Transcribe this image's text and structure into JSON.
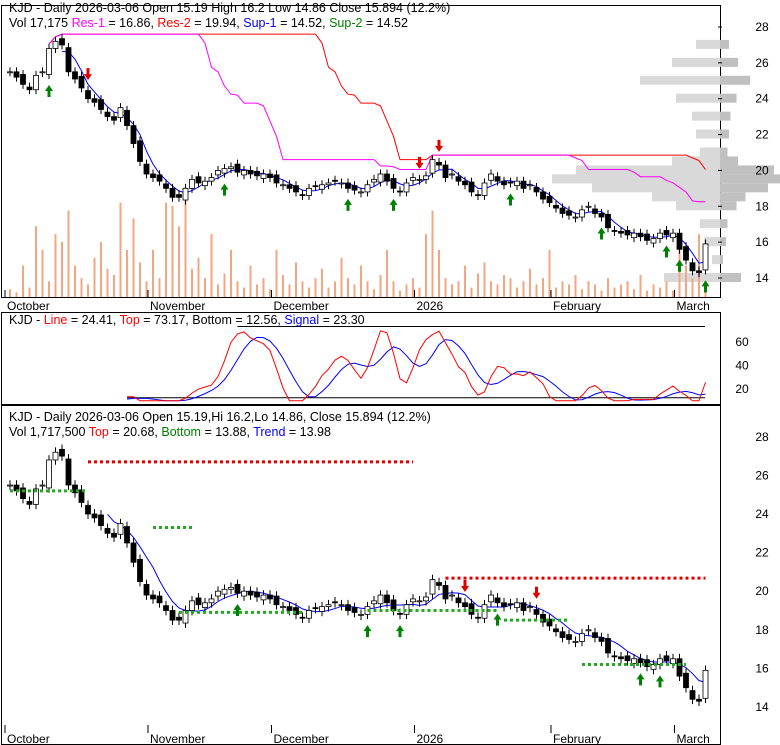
{
  "panel1": {
    "title": "KJD - Daily 2026-03-06 Open 15.19  High 16.2  Low 14.86  Close 15.894 (12.2%)",
    "vol": "Vol 17,175",
    "res1_label": "Res-1",
    "res1_val": " = 16.86, ",
    "res2_label": "Res-2",
    "res2_val": " = 19.94, ",
    "sup1_label": "Sup-1",
    "sup1_val": " = 14.52, ",
    "sup2_label": "Sup-2",
    "sup2_val": " = 14.52"
  },
  "panel2": {
    "ticker": "KJD - ",
    "line_label": "Line",
    "line_val": " = 24.41, ",
    "top_label": "Top",
    "top_val": " = 73.17, ",
    "bottom_label": "Bottom",
    "bottom_val": " = 12.56, ",
    "signal_label": "Signal",
    "signal_val": " = 23.30"
  },
  "panel3": {
    "title": "KJD - Daily 2026-03-06 Open 15.19,Hi 16.2,Lo 14.86, Close 15.894 (12.2%)",
    "vol": "Vol 1,717,500 ",
    "top_label": "Top",
    "top_val": " = 20.68, ",
    "bottom_label": "Bottom",
    "bottom_val": " = 13.88, ",
    "trend_label": "Trend",
    "trend_val": " = 13.98"
  },
  "colors": {
    "res1": "#ff00ff",
    "res2": "#ff0000",
    "sup1": "#0000ff",
    "sup2": "#008000",
    "volume": "#f4a582",
    "profile": "#c0c0c0"
  },
  "chart_data": {
    "type": "candlestick",
    "x_labels": [
      {
        "label": "October",
        "index": 0
      },
      {
        "label": "November",
        "index": 22
      },
      {
        "label": "December",
        "index": 41
      },
      {
        "label": "2026",
        "index": 63
      },
      {
        "label": "February",
        "index": 84
      },
      {
        "label": "March",
        "index": 103
      }
    ],
    "price_ticks": [
      14,
      16,
      18,
      20,
      22,
      24,
      26,
      28
    ],
    "osc_ticks": [
      20,
      40,
      60
    ],
    "ylim": [
      13,
      29
    ],
    "close": [
      25.5,
      25.2,
      24.8,
      24.5,
      25.3,
      25.5,
      26.8,
      27.2,
      27.0,
      25.5,
      25.1,
      24.6,
      24.0,
      23.8,
      23.4,
      23.0,
      22.8,
      23.5,
      22.5,
      21.5,
      20.5,
      19.8,
      19.6,
      19.4,
      19.0,
      18.5,
      18.5,
      19.0,
      19.5,
      19.3,
      19.4,
      19.6,
      20.0,
      20.1,
      20.2,
      19.9,
      20.0,
      19.8,
      19.7,
      19.8,
      19.6,
      19.3,
      19.2,
      19.0,
      18.8,
      18.6,
      19.0,
      19.1,
      19.2,
      19.3,
      19.4,
      19.3,
      19.0,
      18.9,
      18.8,
      19.2,
      19.5,
      19.8,
      19.4,
      19.0,
      18.8,
      19.3,
      19.6,
      19.5,
      19.7,
      20.6,
      20.3,
      19.6,
      19.8,
      19.4,
      19.2,
      18.8,
      18.6,
      19.3,
      19.8,
      19.4,
      19.2,
      19.3,
      19.4,
      19.0,
      19.2,
      18.8,
      18.4,
      18.2,
      17.9,
      17.6,
      17.5,
      17.4,
      17.8,
      18.0,
      17.6,
      17.4,
      16.8,
      16.6,
      16.5,
      16.4,
      16.5,
      16.3,
      16.1,
      16.2,
      16.5,
      16.4,
      16.5,
      15.6,
      15.0,
      14.4,
      14.3,
      15.9
    ],
    "volume": [
      5,
      3,
      20,
      6,
      45,
      30,
      10,
      40,
      35,
      55,
      20,
      12,
      8,
      25,
      35,
      18,
      14,
      60,
      30,
      50,
      22,
      10,
      30,
      12,
      60,
      58,
      45,
      70,
      18,
      25,
      12,
      40,
      8,
      15,
      30,
      10,
      6,
      20,
      8,
      12,
      5,
      30,
      14,
      8,
      22,
      10,
      6,
      12,
      18,
      6,
      10,
      25,
      12,
      8,
      20,
      10,
      5,
      14,
      30,
      10,
      4,
      8,
      12,
      6,
      40,
      55,
      30,
      12,
      8,
      10,
      20,
      6,
      15,
      22,
      10,
      8,
      14,
      12,
      6,
      10,
      18,
      8,
      12,
      30,
      6,
      10,
      8,
      14,
      5,
      10,
      8,
      4,
      12,
      6,
      8,
      10,
      5,
      14,
      4,
      8,
      6,
      10,
      4,
      30,
      20,
      12,
      40,
      10
    ],
    "up_arrows_top": [
      6,
      33,
      52,
      59,
      77,
      91,
      101,
      103,
      107
    ],
    "down_arrows_top": [
      12,
      63,
      66
    ],
    "up_arrows_bottom": [
      35,
      55,
      60,
      75,
      97,
      100
    ],
    "down_arrows_bottom": [
      70,
      81
    ],
    "volume_profile": [
      {
        "price": 14,
        "size": 70
      },
      {
        "price": 15,
        "size": 10
      },
      {
        "price": 16,
        "size": 20
      },
      {
        "price": 17,
        "size": 25
      },
      {
        "price": 18,
        "size": 55
      },
      {
        "price": 18.5,
        "size": 85
      },
      {
        "price": 19,
        "size": 160
      },
      {
        "price": 19.5,
        "size": 210
      },
      {
        "price": 20,
        "size": 180
      },
      {
        "price": 20.5,
        "size": 60
      },
      {
        "price": 21,
        "size": 25
      },
      {
        "price": 22,
        "size": 30
      },
      {
        "price": 23,
        "size": 35
      },
      {
        "price": 24,
        "size": 55
      },
      {
        "price": 25,
        "size": 100
      },
      {
        "price": 26,
        "size": 60
      },
      {
        "price": 27,
        "size": 30
      }
    ],
    "resistance_lines_bottom": [
      {
        "from": 12,
        "to": 62,
        "price": 26.7
      },
      {
        "from": 67,
        "to": 107,
        "price": 20.68
      }
    ],
    "support_lines_bottom": [
      {
        "from": 0,
        "to": 12,
        "price": 25.2
      },
      {
        "from": 22,
        "to": 28,
        "price": 23.3
      },
      {
        "from": 26,
        "to": 45,
        "price": 18.9
      },
      {
        "from": 55,
        "to": 75,
        "price": 19.0
      },
      {
        "from": 76,
        "to": 86,
        "price": 18.5
      },
      {
        "from": 88,
        "to": 104,
        "price": 16.2
      }
    ],
    "osc_top": 73.17,
    "osc_bottom": 12.56
  }
}
